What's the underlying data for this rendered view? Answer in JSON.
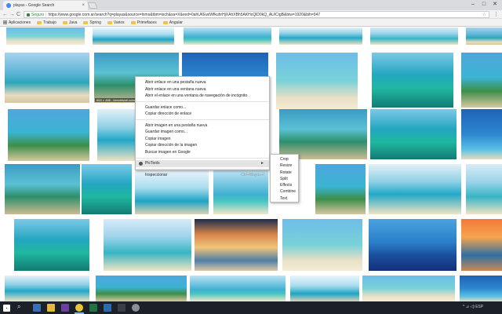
{
  "browser": {
    "tab_title": "playas - Google Search",
    "tab_close": "×",
    "minimize": "–",
    "maximize": "□",
    "close": "✕",
    "back": "←",
    "forward": "→",
    "reload": "C",
    "secure_label": "Seguro",
    "separator": "|",
    "url": "https://www.google.com.ar/search?q=playas&source=lnms&tbm=isch&sa=X&ved=0ahUKEwiWfkuhrHjXAhXBh5AKHcQlD0kQ_AUICigB&biw=1920&bih=947",
    "star": "☆",
    "menu": "⋮"
  },
  "bookmarks": [
    {
      "label": "Aplicaciones",
      "icon": "apps-icon"
    },
    {
      "label": "Trabajo",
      "icon": "folder-icon"
    },
    {
      "label": "Java",
      "icon": "folder-icon"
    },
    {
      "label": "Spring",
      "icon": "folder-icon"
    },
    {
      "label": "Varios",
      "icon": "folder-icon"
    },
    {
      "label": "Primefaces",
      "icon": "folder-icon"
    },
    {
      "label": "Angular",
      "icon": "folder-icon"
    }
  ],
  "image_overlay_label": "600 × 466 - kenvelsvel.com",
  "context_menu": {
    "items": [
      "Abrir enlace en una pestaña nueva",
      "Abrir enlace en una ventana nueva",
      "Abrir el enlace en una ventana de navegación de incógnito",
      "Guardar enlace como...",
      "Copiar dirección de enlace",
      "Abrir imagen en una pestaña nueva",
      "Guardar imagen como...",
      "Copiar imagen",
      "Copiar dirección de la imagen",
      "Buscar imagen en Google",
      "PicTools",
      "Inspeccionar"
    ],
    "pictools_arrow": "►",
    "inspect_shortcut": "Ctrl+Mayús+I"
  },
  "submenu": {
    "items": [
      "Crop",
      "Resize",
      "Rotate",
      "Split",
      "Effects",
      "Combine",
      "Text"
    ]
  },
  "colors": {
    "chrome_bg": "#f2f2f2",
    "secure_green": "#2e8b3e",
    "taskbar": "#1c2127"
  },
  "taskbar": {
    "search": "⌕",
    "task_view": "❐",
    "tray": "^ ⊿ ◁) ESP"
  }
}
